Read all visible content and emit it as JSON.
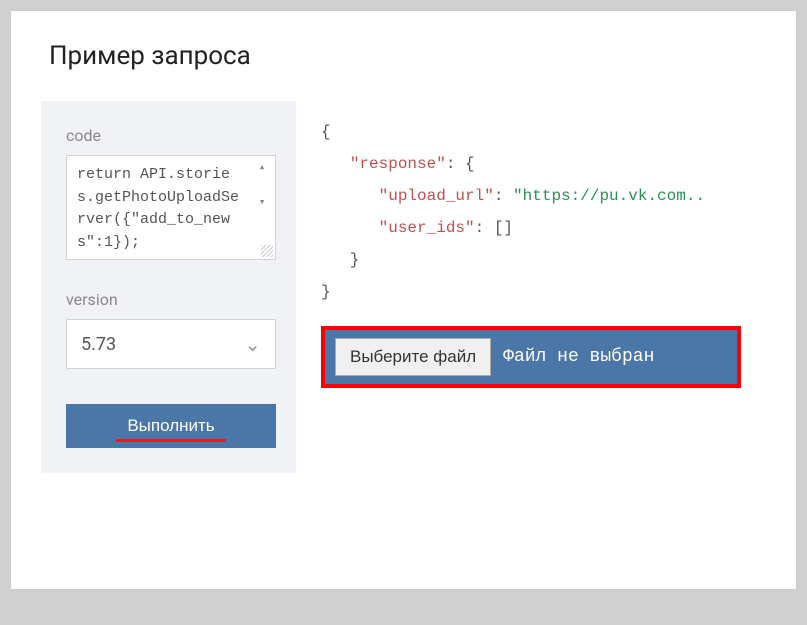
{
  "title": "Пример запроса",
  "left": {
    "code_label": "code",
    "code_text": "return API.stories.getPhotoUploadServer({\"add_to_news\":1});",
    "version_label": "version",
    "version_value": "5.73",
    "execute_label": "Выполнить"
  },
  "response": {
    "lines": [
      {
        "indent": 0,
        "text": "{"
      },
      {
        "indent": 1,
        "key": "\"response\"",
        "sep": ": {"
      },
      {
        "indent": 2,
        "key": "\"upload_url\"",
        "sep": ": ",
        "str": "\"https://pu.vk.com.."
      },
      {
        "indent": 2,
        "key": "\"user_ids\"",
        "sep": ": []"
      },
      {
        "indent": 1,
        "text": "}"
      },
      {
        "indent": 0,
        "text": "}"
      }
    ]
  },
  "file": {
    "choose_label": "Выберите файл",
    "status_label": "Файл не выбран"
  }
}
